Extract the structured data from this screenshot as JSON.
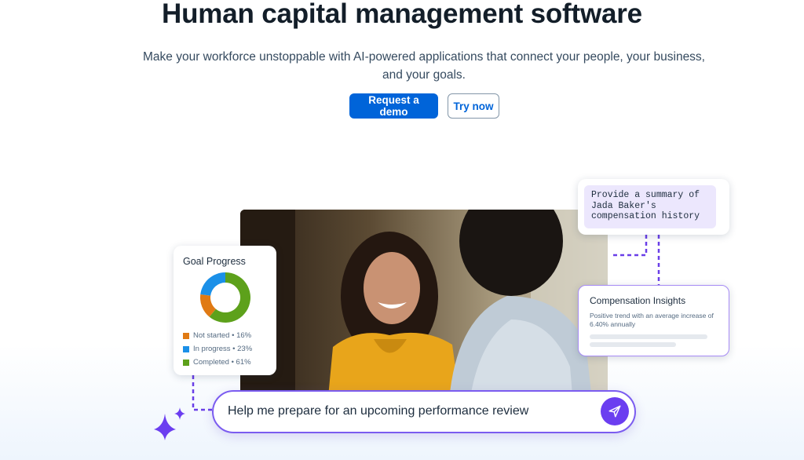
{
  "hero": {
    "title": "Human capital management software",
    "subtitle": "Make your workforce unstoppable with AI-powered applications that connect your people, your business, and your goals.",
    "primary_button": "Request a demo",
    "secondary_button": "Try now"
  },
  "goal_card": {
    "title": "Goal Progress",
    "items": [
      {
        "label": "Not started • 16%",
        "value": 16,
        "color": "#e07a14"
      },
      {
        "label": "In progress • 23%",
        "value": 23,
        "color": "#1b90e8"
      },
      {
        "label": "Completed • 61%",
        "value": 61,
        "color": "#5da11b"
      }
    ]
  },
  "prompt_card": {
    "text": "Provide a summary of Jada Baker's compensation history"
  },
  "insights_card": {
    "title": "Compensation Insights",
    "text": "Positive trend with an average increase of 6.40% annually"
  },
  "chat": {
    "text": "Help me prepare for an upcoming performance review",
    "send_icon": "send-icon"
  },
  "colors": {
    "primary": "#0064d9",
    "ai_purple": "#6b3ef0",
    "connector": "#6a3fe8"
  }
}
